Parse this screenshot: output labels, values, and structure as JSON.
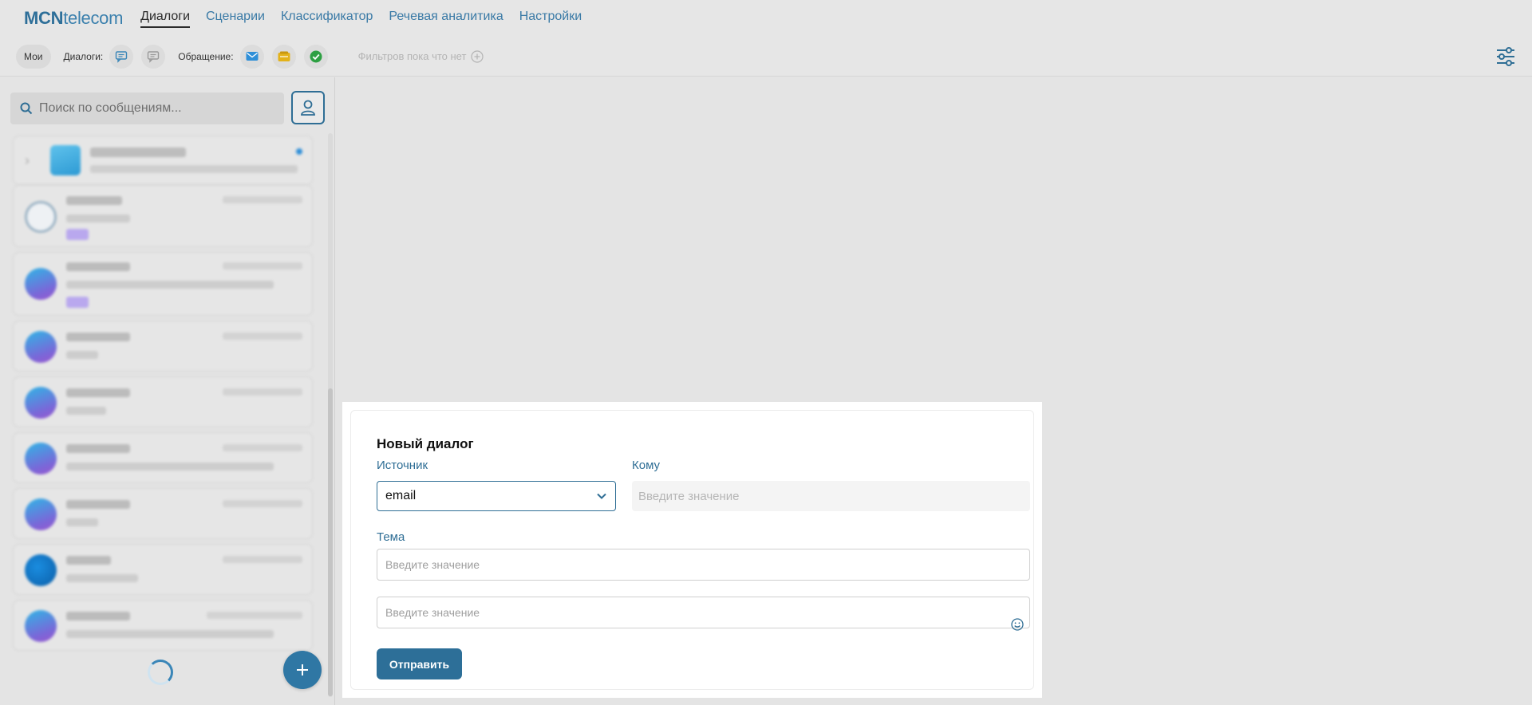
{
  "logo": {
    "bold": "MCN",
    "thin": "telecom"
  },
  "nav": {
    "items": [
      {
        "label": "Диалоги",
        "active": true
      },
      {
        "label": "Сценарии",
        "active": false
      },
      {
        "label": "Классификатор",
        "active": false
      },
      {
        "label": "Речевая аналитика",
        "active": false
      },
      {
        "label": "Настройки",
        "active": false
      }
    ]
  },
  "filters": {
    "mine_label": "Мои",
    "dialogs_label": "Диалоги:",
    "appeal_label": "Обращение:",
    "no_filters": "Фильтров пока что нет",
    "colors": {
      "mail": "#2f8fd8",
      "folder": "#e3b21a",
      "check": "#2ea043"
    }
  },
  "sidebar": {
    "search_placeholder": "Поиск по сообщениям..."
  },
  "dialog": {
    "title": "Новый диалог",
    "source_label": "Источник",
    "source_value": "email",
    "to_label": "Кому",
    "to_placeholder": "Введите значение",
    "subject_label": "Тема",
    "subject_placeholder": "Введите значение",
    "message_placeholder": "Введите значение",
    "send_label": "Отправить"
  },
  "colors": {
    "accent": "#2f6e95",
    "link": "#3a7aa6",
    "background": "#e4e4e4"
  }
}
